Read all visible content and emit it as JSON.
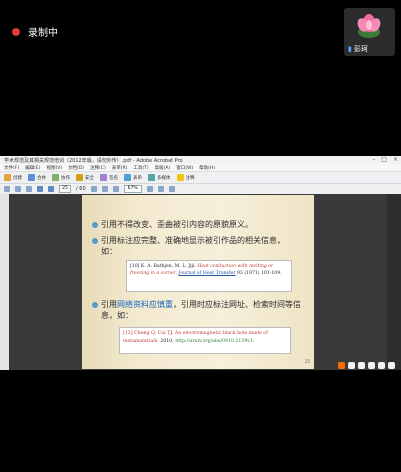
{
  "recording": {
    "label": "录制中"
  },
  "participant": {
    "name": "彭珂"
  },
  "window": {
    "title": "学术规范及其相关规范培训（2012年版，请勿外传）.pdf - Adobe Acrobat Pro",
    "menu": [
      "文件(F)",
      "编辑(E)",
      "视图(V)",
      "文档(D)",
      "注释(C)",
      "表单(R)",
      "工具(T)",
      "高级(A)",
      "窗口(W)",
      "帮助(H)"
    ],
    "toolbar": [
      "创建",
      "合并",
      "协作",
      "安全",
      "签名",
      "表单",
      "多媒体",
      "注释"
    ],
    "page_current": "25",
    "page_total": "/ 60",
    "zoom": "67%"
  },
  "slide": {
    "bullet1": "引用不得改变、歪曲被引内容的原貌原义。",
    "bullet2": "引用标注应完整、准确地显示被引作品的相关信息，如：",
    "ref1": {
      "num": "[10]",
      "authors": "K. A. Rathjen, M. L. Jiji.",
      "title": "Heat conduction with melting or freezing in a corner,",
      "journal": "Journal of Heat Transfer",
      "vol": "93",
      "rest": "(1971) 101-109."
    },
    "bullet3_pre": "引用",
    "bullet3_link": "网络资料应慎重",
    "bullet3_post": "，引用时应标注网址、检索时间等信息，如：",
    "ref2": {
      "num": "[12]",
      "authors": "Cheng Q, Cui TJ.",
      "title": "An electromagnetic black hole made of metamaterials.",
      "year": "2010;",
      "url": "http://arxiv.org/abs/0910.2159v1."
    },
    "page_number": "25"
  },
  "colors": {
    "bullet": "#4aa0c8",
    "accent_red": "#c0392b",
    "accent_blue": "#1565c0"
  }
}
